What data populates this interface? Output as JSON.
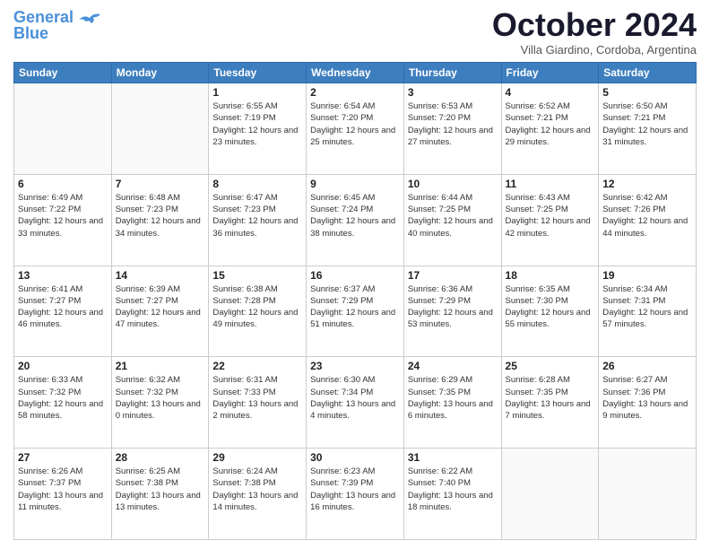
{
  "logo": {
    "line1": "General",
    "line2": "Blue"
  },
  "title": "October 2024",
  "location": "Villa Giardino, Cordoba, Argentina",
  "days_of_week": [
    "Sunday",
    "Monday",
    "Tuesday",
    "Wednesday",
    "Thursday",
    "Friday",
    "Saturday"
  ],
  "weeks": [
    [
      {
        "day": "",
        "info": ""
      },
      {
        "day": "",
        "info": ""
      },
      {
        "day": "1",
        "info": "Sunrise: 6:55 AM\nSunset: 7:19 PM\nDaylight: 12 hours and 23 minutes."
      },
      {
        "day": "2",
        "info": "Sunrise: 6:54 AM\nSunset: 7:20 PM\nDaylight: 12 hours and 25 minutes."
      },
      {
        "day": "3",
        "info": "Sunrise: 6:53 AM\nSunset: 7:20 PM\nDaylight: 12 hours and 27 minutes."
      },
      {
        "day": "4",
        "info": "Sunrise: 6:52 AM\nSunset: 7:21 PM\nDaylight: 12 hours and 29 minutes."
      },
      {
        "day": "5",
        "info": "Sunrise: 6:50 AM\nSunset: 7:21 PM\nDaylight: 12 hours and 31 minutes."
      }
    ],
    [
      {
        "day": "6",
        "info": "Sunrise: 6:49 AM\nSunset: 7:22 PM\nDaylight: 12 hours and 33 minutes."
      },
      {
        "day": "7",
        "info": "Sunrise: 6:48 AM\nSunset: 7:23 PM\nDaylight: 12 hours and 34 minutes."
      },
      {
        "day": "8",
        "info": "Sunrise: 6:47 AM\nSunset: 7:23 PM\nDaylight: 12 hours and 36 minutes."
      },
      {
        "day": "9",
        "info": "Sunrise: 6:45 AM\nSunset: 7:24 PM\nDaylight: 12 hours and 38 minutes."
      },
      {
        "day": "10",
        "info": "Sunrise: 6:44 AM\nSunset: 7:25 PM\nDaylight: 12 hours and 40 minutes."
      },
      {
        "day": "11",
        "info": "Sunrise: 6:43 AM\nSunset: 7:25 PM\nDaylight: 12 hours and 42 minutes."
      },
      {
        "day": "12",
        "info": "Sunrise: 6:42 AM\nSunset: 7:26 PM\nDaylight: 12 hours and 44 minutes."
      }
    ],
    [
      {
        "day": "13",
        "info": "Sunrise: 6:41 AM\nSunset: 7:27 PM\nDaylight: 12 hours and 46 minutes."
      },
      {
        "day": "14",
        "info": "Sunrise: 6:39 AM\nSunset: 7:27 PM\nDaylight: 12 hours and 47 minutes."
      },
      {
        "day": "15",
        "info": "Sunrise: 6:38 AM\nSunset: 7:28 PM\nDaylight: 12 hours and 49 minutes."
      },
      {
        "day": "16",
        "info": "Sunrise: 6:37 AM\nSunset: 7:29 PM\nDaylight: 12 hours and 51 minutes."
      },
      {
        "day": "17",
        "info": "Sunrise: 6:36 AM\nSunset: 7:29 PM\nDaylight: 12 hours and 53 minutes."
      },
      {
        "day": "18",
        "info": "Sunrise: 6:35 AM\nSunset: 7:30 PM\nDaylight: 12 hours and 55 minutes."
      },
      {
        "day": "19",
        "info": "Sunrise: 6:34 AM\nSunset: 7:31 PM\nDaylight: 12 hours and 57 minutes."
      }
    ],
    [
      {
        "day": "20",
        "info": "Sunrise: 6:33 AM\nSunset: 7:32 PM\nDaylight: 12 hours and 58 minutes."
      },
      {
        "day": "21",
        "info": "Sunrise: 6:32 AM\nSunset: 7:32 PM\nDaylight: 13 hours and 0 minutes."
      },
      {
        "day": "22",
        "info": "Sunrise: 6:31 AM\nSunset: 7:33 PM\nDaylight: 13 hours and 2 minutes."
      },
      {
        "day": "23",
        "info": "Sunrise: 6:30 AM\nSunset: 7:34 PM\nDaylight: 13 hours and 4 minutes."
      },
      {
        "day": "24",
        "info": "Sunrise: 6:29 AM\nSunset: 7:35 PM\nDaylight: 13 hours and 6 minutes."
      },
      {
        "day": "25",
        "info": "Sunrise: 6:28 AM\nSunset: 7:35 PM\nDaylight: 13 hours and 7 minutes."
      },
      {
        "day": "26",
        "info": "Sunrise: 6:27 AM\nSunset: 7:36 PM\nDaylight: 13 hours and 9 minutes."
      }
    ],
    [
      {
        "day": "27",
        "info": "Sunrise: 6:26 AM\nSunset: 7:37 PM\nDaylight: 13 hours and 11 minutes."
      },
      {
        "day": "28",
        "info": "Sunrise: 6:25 AM\nSunset: 7:38 PM\nDaylight: 13 hours and 13 minutes."
      },
      {
        "day": "29",
        "info": "Sunrise: 6:24 AM\nSunset: 7:38 PM\nDaylight: 13 hours and 14 minutes."
      },
      {
        "day": "30",
        "info": "Sunrise: 6:23 AM\nSunset: 7:39 PM\nDaylight: 13 hours and 16 minutes."
      },
      {
        "day": "31",
        "info": "Sunrise: 6:22 AM\nSunset: 7:40 PM\nDaylight: 13 hours and 18 minutes."
      },
      {
        "day": "",
        "info": ""
      },
      {
        "day": "",
        "info": ""
      }
    ]
  ]
}
